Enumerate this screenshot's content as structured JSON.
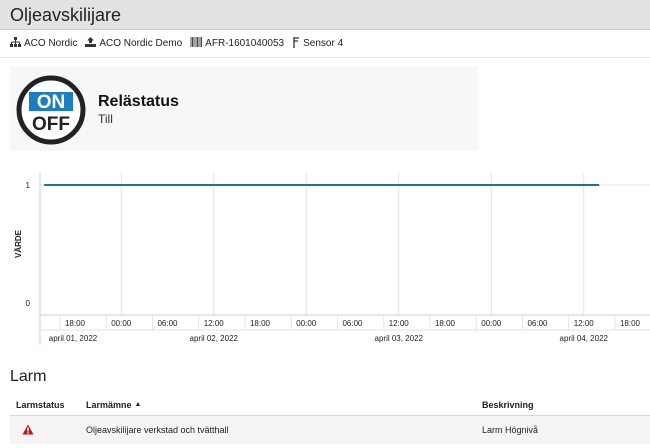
{
  "window": {
    "title": "Oljeavskilijare"
  },
  "breadcrumb": [
    {
      "icon": "sitemap-icon",
      "label": "ACO Nordic"
    },
    {
      "icon": "upload-icon",
      "label": "ACO Nordic Demo"
    },
    {
      "icon": "barcode-icon",
      "label": "AFR-1601040053"
    },
    {
      "icon": "sensor-icon",
      "label": "Sensor 4"
    }
  ],
  "status_card": {
    "logo_text_top": "ON",
    "logo_text_bottom": "OFF",
    "heading": "Relästatus",
    "value": "Till"
  },
  "chart_data": {
    "type": "line",
    "ylabel": "VÄRDE",
    "ylim": [
      0,
      1
    ],
    "y_ticks": [
      "1",
      "0"
    ],
    "x_time_ticks": [
      "18:00",
      "00:00",
      "06:00",
      "12:00",
      "18:00",
      "00:00",
      "06:00",
      "12:00",
      "18:00",
      "00:00",
      "06:00",
      "12:00",
      "18:00"
    ],
    "x_date_ticks": [
      "april 01, 2022",
      "april 02, 2022",
      "april 03, 2022",
      "april 04, 2022"
    ],
    "series": [
      {
        "color": "#1f6f9b",
        "x": [
          "2022-04-01 14:00",
          "2022-04-04 14:00"
        ],
        "values": [
          1,
          1
        ]
      }
    ]
  },
  "alarms": {
    "title": "Larm",
    "columns": [
      "Larmstatus",
      "Larmämne",
      "Beskrivning"
    ],
    "sort_indicator": "▲",
    "rows": [
      {
        "status_icon": "warning-icon",
        "subject": "Oljeavskilijare verkstad och tvätthall",
        "description": "Larm Högnivå"
      }
    ]
  }
}
